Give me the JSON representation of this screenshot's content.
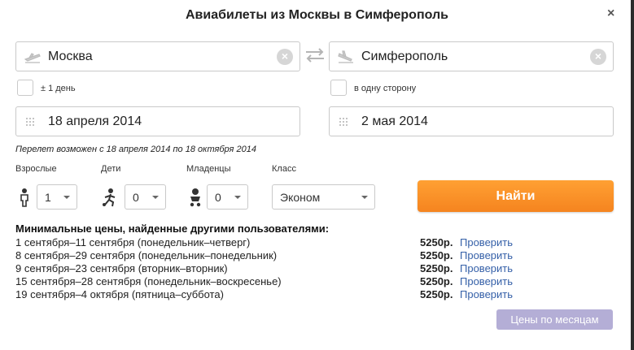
{
  "title": "Авиабилеты из Москвы в Симферополь",
  "close_label": "×",
  "from": {
    "value": "Москва",
    "icon": "plane-takeoff-icon"
  },
  "to": {
    "value": "Симферополь",
    "icon": "plane-landing-icon"
  },
  "flex_dates_label": "± 1 день",
  "one_way_label": "в одну сторону",
  "depart_date": "18 апреля 2014",
  "return_date": "2 мая 2014",
  "flight_note": "Перелет возможен с 18 апреля 2014 по 18 октября 2014",
  "passengers": {
    "adults_label": "Взрослые",
    "adults_value": "1",
    "children_label": "Дети",
    "children_value": "0",
    "infants_label": "Младенцы",
    "infants_value": "0",
    "class_label": "Класс",
    "class_value": "Эконом"
  },
  "search_button": "Найти",
  "min_prices": {
    "heading": "Минимальные цены, найденные другими пользователями:",
    "rows": [
      {
        "dates": "1 сентября–11 сентября (понедельник–четверг)",
        "price": "5250р.",
        "action": "Проверить"
      },
      {
        "dates": "8 сентября–29 сентября (понедельник–понедельник)",
        "price": "5250р.",
        "action": "Проверить"
      },
      {
        "dates": "9 сентября–23 сентября (вторник–вторник)",
        "price": "5250р.",
        "action": "Проверить"
      },
      {
        "dates": "15 сентября–28 сентября (понедельник–воскресенье)",
        "price": "5250р.",
        "action": "Проверить"
      },
      {
        "dates": "19 сентября–4 октября (пятница–суббота)",
        "price": "5250р.",
        "action": "Проверить"
      }
    ]
  },
  "prices_by_month_button": "Цены по месяцам",
  "colors": {
    "accent_orange": "#f5841f",
    "link_blue": "#3560a8",
    "months_button": "#b4aed6"
  }
}
